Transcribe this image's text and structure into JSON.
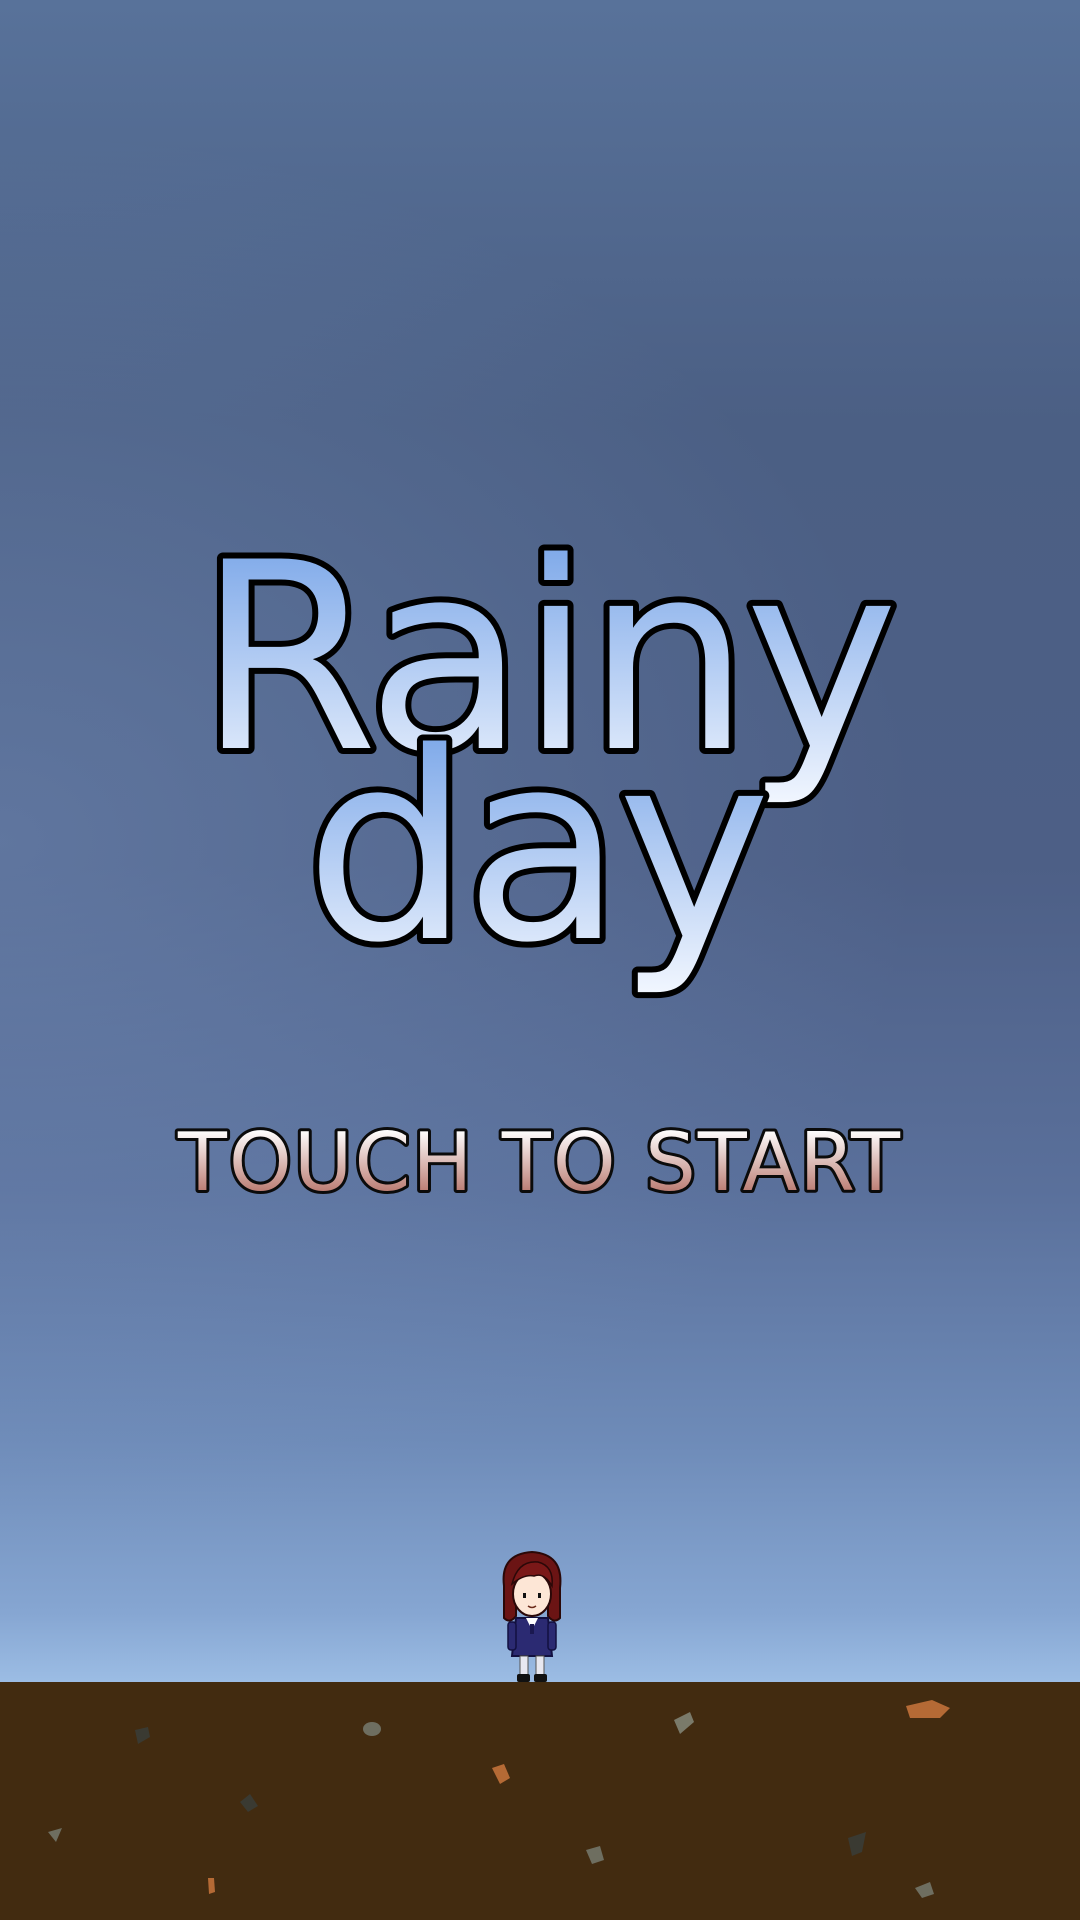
{
  "game": {
    "title_line1": "Rainy",
    "title_line2": "day",
    "start_prompt": "TOUCH TO START"
  },
  "colors": {
    "sky_top": "#58729a",
    "sky_bottom": "#9ebfe6",
    "title_fill_top": "#6e9ee6",
    "title_fill_bottom": "#f4f8ff",
    "start_fill_top": "#ffffff",
    "start_fill_bottom": "#a8584c",
    "ground": "#422b10"
  },
  "sprites": {
    "player": "girl-character",
    "ground_decor": "pebbles"
  }
}
